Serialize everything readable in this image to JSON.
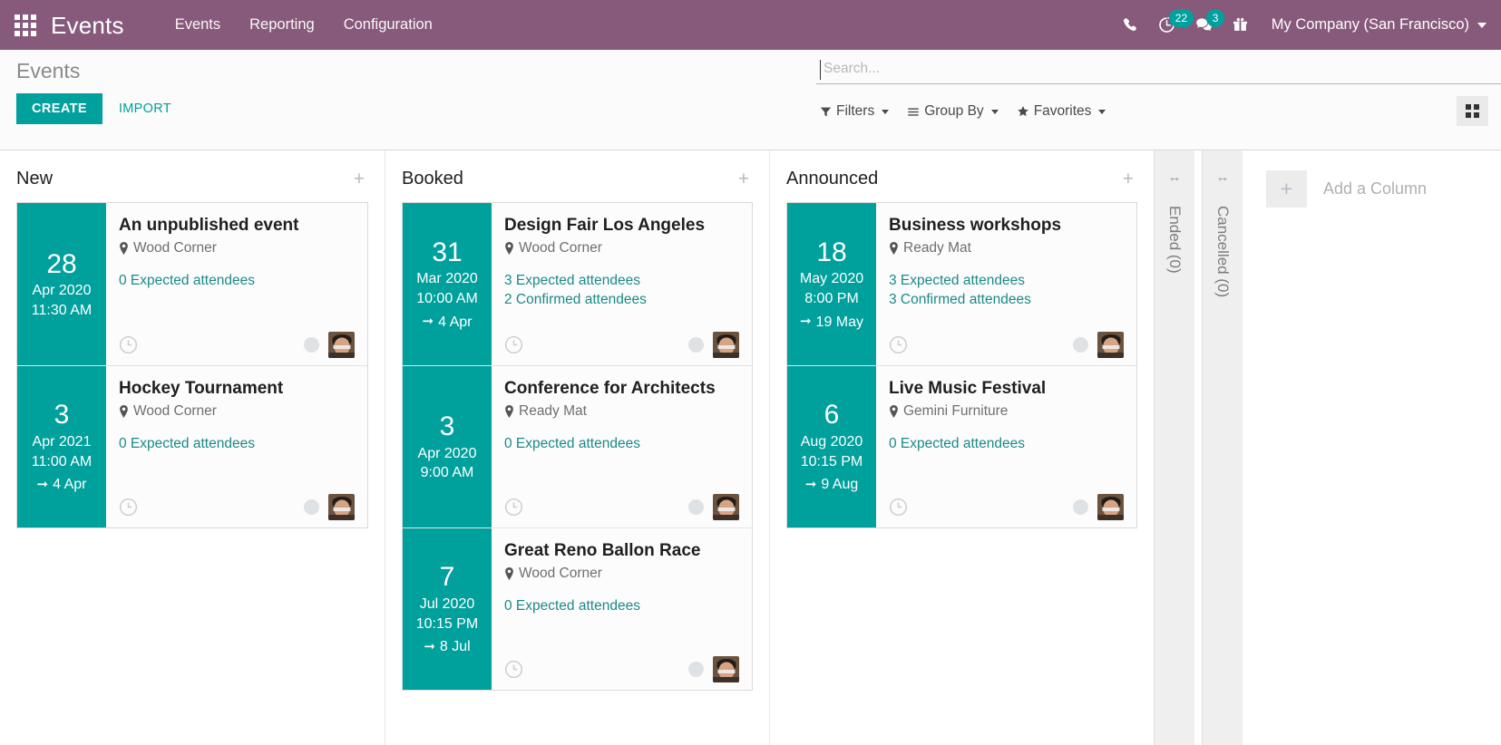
{
  "navbar": {
    "apps_icon": "grid-apps-icon",
    "brand": "Events",
    "menu": [
      {
        "label": "Events"
      },
      {
        "label": "Reporting"
      },
      {
        "label": "Configuration"
      }
    ],
    "icons": {
      "phone": "phone-icon",
      "activity": "clock-activity-icon",
      "messages": "chat-bubble-icon",
      "gift": "gift-icon"
    },
    "activity_count": "22",
    "message_count": "3",
    "company": "My Company (San Francisco)",
    "accent_purple": "#875A7B",
    "accent_teal": "#00A09D"
  },
  "control_panel": {
    "breadcrumb": "Events",
    "create_label": "CREATE",
    "import_label": "IMPORT",
    "search": {
      "placeholder": "Search...",
      "value": ""
    },
    "filters": [
      {
        "label": "Filters",
        "icon": "filter-funnel-icon"
      },
      {
        "label": "Group By",
        "icon": "group-lines-icon"
      },
      {
        "label": "Favorites",
        "icon": "star-icon"
      }
    ],
    "view_switcher_icon": "kanban-view-icon"
  },
  "kanban": {
    "add_column_label": "Add a Column",
    "add_column_icon": "plus-icon",
    "columns": [
      {
        "title": "New",
        "add_icon": "plus-icon",
        "cards": [
          {
            "day": "28",
            "month_year": "Apr 2020",
            "time": "11:30 AM",
            "end": "",
            "title": "An unpublished event",
            "location": "Wood Corner",
            "stats": [
              "0 Expected attendees"
            ],
            "clock_icon": "clock-icon",
            "color_dot": "#dfe2e5",
            "avatar": "user-avatar"
          },
          {
            "day": "3",
            "month_year": "Apr 2021",
            "time": "11:00 AM",
            "end": "4 Apr",
            "title": "Hockey Tournament",
            "location": "Wood Corner",
            "stats": [
              "0 Expected attendees"
            ],
            "clock_icon": "clock-icon",
            "color_dot": "#dfe2e5",
            "avatar": "user-avatar"
          }
        ]
      },
      {
        "title": "Booked",
        "add_icon": "plus-icon",
        "cards": [
          {
            "day": "31",
            "month_year": "Mar 2020",
            "time": "10:00 AM",
            "end": "4 Apr",
            "title": "Design Fair Los Angeles",
            "location": "Wood Corner",
            "stats": [
              "3 Expected attendees",
              "2 Confirmed attendees"
            ],
            "clock_icon": "clock-icon",
            "color_dot": "#dfe2e5",
            "avatar": "user-avatar"
          },
          {
            "day": "3",
            "month_year": "Apr 2020",
            "time": "9:00 AM",
            "end": "",
            "title": "Conference for Architects",
            "location": "Ready Mat",
            "stats": [
              "0 Expected attendees"
            ],
            "clock_icon": "clock-icon",
            "color_dot": "#dfe2e5",
            "avatar": "user-avatar"
          },
          {
            "day": "7",
            "month_year": "Jul 2020",
            "time": "10:15 PM",
            "end": "8 Jul",
            "title": "Great Reno Ballon Race",
            "location": "Wood Corner",
            "stats": [
              "0 Expected attendees"
            ],
            "clock_icon": "clock-icon",
            "color_dot": "#dfe2e5",
            "avatar": "user-avatar"
          }
        ]
      },
      {
        "title": "Announced",
        "add_icon": "plus-icon",
        "cards": [
          {
            "day": "18",
            "month_year": "May 2020",
            "time": "8:00 PM",
            "end": "19 May",
            "title": "Business workshops",
            "location": "Ready Mat",
            "stats": [
              "3 Expected attendees",
              "3 Confirmed attendees"
            ],
            "clock_icon": "clock-icon",
            "color_dot": "#dfe2e5",
            "avatar": "user-avatar"
          },
          {
            "day": "6",
            "month_year": "Aug 2020",
            "time": "10:15 PM",
            "end": "9 Aug",
            "title": "Live Music Festival",
            "location": "Gemini Furniture",
            "stats": [
              "0 Expected attendees"
            ],
            "clock_icon": "clock-icon",
            "color_dot": "#dfe2e5",
            "avatar": "user-avatar"
          }
        ]
      }
    ],
    "folded_columns": [
      {
        "label": "Ended (0)",
        "arrows": "↔"
      },
      {
        "label": "Cancelled (0)",
        "arrows": "↔"
      }
    ]
  }
}
